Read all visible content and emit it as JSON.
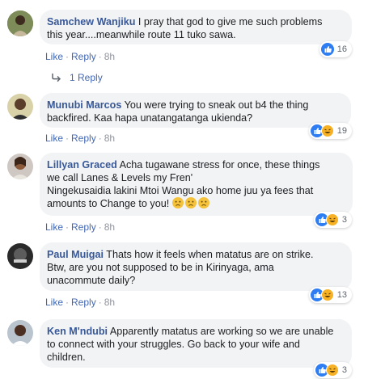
{
  "comments": [
    {
      "author": "Samchew Wanjiku",
      "text1": "I pray that god to give me such problems",
      "text2": "this year....meanwhile route 11 tuko sawa.",
      "like_label": "Like",
      "reply_label": "Reply",
      "time": "8h",
      "reaction_count": "16",
      "reactions": [
        "like"
      ]
    },
    {
      "author": "Munubi Marcos",
      "text1": "You were trying to sneak out b4 the thing",
      "text2": "backfired. Kaa hapa unatangatanga ukienda?",
      "like_label": "Like",
      "reply_label": "Reply",
      "time": "8h",
      "reaction_count": "19",
      "reactions": [
        "like",
        "haha"
      ]
    },
    {
      "author": "Lillyan Graced",
      "text1": "Acha tugawane stress for once, these things",
      "text2": "we call Lanes & Levels my Fren'",
      "text3": "Ningekusaidia lakini Mtoi Wangu ako home juu ya fees that",
      "text4": "amounts to Change to you!",
      "like_label": "Like",
      "reply_label": "Reply",
      "time": "8h",
      "reaction_count": "3",
      "reactions": [
        "like",
        "haha"
      ]
    },
    {
      "author": "Paul Muigai",
      "text1": "Thats how it feels when matatus are on strike.",
      "text2": "Btw, are you not supposed to be in Kirinyaga, ama",
      "text3": "unacommute daily?",
      "like_label": "Like",
      "reply_label": "Reply",
      "time": "8h",
      "reaction_count": "13",
      "reactions": [
        "like",
        "haha"
      ]
    },
    {
      "author": "Ken M'ndubi",
      "text1": "Apparently matatus are working so we are unable",
      "text2": "to connect with your struggles. Go back to your wife and",
      "text3": "children.",
      "reaction_count": "3",
      "reactions": [
        "like",
        "haha"
      ]
    }
  ],
  "replies_link": "1 Reply",
  "colors": {
    "author": "#385898",
    "bubble": "#f2f3f5",
    "link": "#4267b2",
    "like": "#2e7df2",
    "haha": "#f7b125"
  }
}
